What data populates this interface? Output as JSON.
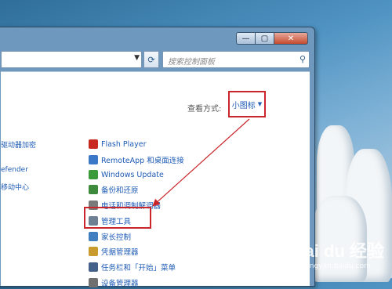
{
  "window": {
    "caption_buttons": {
      "minimize": "—",
      "maximize": "▢",
      "close": "✕"
    },
    "search_placeholder": "搜索控制面板",
    "address_dropdown_icon": "chevron-down-icon",
    "refresh_icon": "refresh-icon"
  },
  "view": {
    "label": "查看方式:",
    "selected": "小图标",
    "caret": "▼"
  },
  "left_items": [
    "驱动器加密",
    "efender",
    "移动中心"
  ],
  "items": [
    {
      "label": "Flash Player",
      "icon": "flash-icon",
      "color": "#c8281f"
    },
    {
      "label": "RemoteApp 和桌面连接",
      "icon": "remoteapp-icon",
      "color": "#3c78c8"
    },
    {
      "label": "Windows Update",
      "icon": "windows-update-icon",
      "color": "#3a9a3a"
    },
    {
      "label": "备份和还原",
      "icon": "backup-icon",
      "color": "#3d8a3d"
    },
    {
      "label": "电话和调制解调器",
      "icon": "phone-modem-icon",
      "color": "#7a7a7a"
    },
    {
      "label": "管理工具",
      "icon": "admin-tools-icon",
      "color": "#6d7f93"
    },
    {
      "label": "家长控制",
      "icon": "parental-control-icon",
      "color": "#3f7fc0"
    },
    {
      "label": "凭据管理器",
      "icon": "credential-manager-icon",
      "color": "#c99a2c"
    },
    {
      "label": "任务栏和「开始」菜单",
      "icon": "taskbar-icon",
      "color": "#44618a"
    },
    {
      "label": "设备管理器",
      "icon": "device-manager-icon",
      "color": "#707070"
    }
  ],
  "watermark": {
    "logo": "Bai du 经验",
    "url": "jingyan.baidu.com"
  },
  "colors": {
    "link": "#1e5bb5",
    "highlight": "#c9262b"
  }
}
